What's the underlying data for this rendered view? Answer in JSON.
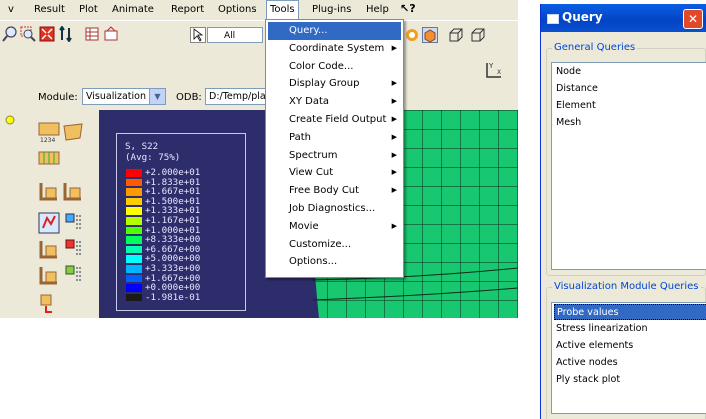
{
  "menubar": {
    "items": [
      "v",
      "Result",
      "Plot",
      "Animate",
      "Report",
      "Options",
      "Tools",
      "Plug-ins",
      "Help"
    ],
    "active": "Tools"
  },
  "toolbar": {
    "selection_combo": "All"
  },
  "context_bar": {
    "module_label": "Module:",
    "module_value": "Visualization",
    "odb_label": "ODB:",
    "odb_value": "D:/Temp/pla"
  },
  "legend": {
    "title": "S, S22",
    "subtitle": "(Avg: 75%)",
    "values": [
      "+2.000e+01",
      "+1.833e+01",
      "+1.667e+01",
      "+1.500e+01",
      "+1.333e+01",
      "+1.167e+01",
      "+1.000e+01",
      "+8.333e+00",
      "+6.667e+00",
      "+5.000e+00",
      "+3.333e+00",
      "+1.667e+00",
      "+0.000e+00",
      "-1.981e-01"
    ],
    "colors": [
      "#ff0000",
      "#ff5a00",
      "#ff9900",
      "#ffcc00",
      "#ffff00",
      "#b3ff00",
      "#4dff00",
      "#00ff5a",
      "#00ffb0",
      "#00ffff",
      "#00b4ff",
      "#0060ff",
      "#0000ff",
      "#1a1a1a"
    ]
  },
  "tools_menu": {
    "items": [
      {
        "label": "Query...",
        "submenu": false,
        "selected": true
      },
      {
        "label": "Coordinate System",
        "submenu": true
      },
      {
        "label": "Color Code...",
        "submenu": false
      },
      {
        "label": "Display Group",
        "submenu": true
      },
      {
        "label": "XY Data",
        "submenu": true
      },
      {
        "label": "Create Field Output",
        "submenu": true
      },
      {
        "label": "Path",
        "submenu": true
      },
      {
        "label": "Spectrum",
        "submenu": true
      },
      {
        "label": "View Cut",
        "submenu": true
      },
      {
        "label": "Free Body Cut",
        "submenu": true
      },
      {
        "label": "Job Diagnostics...",
        "submenu": false
      },
      {
        "label": "Movie",
        "submenu": true
      },
      {
        "label": "Customize...",
        "submenu": false
      },
      {
        "label": "Options...",
        "submenu": false
      }
    ]
  },
  "query_dialog": {
    "title": "Query",
    "general_title": "General Queries",
    "general_items": [
      "Node",
      "Distance",
      "Element",
      "Mesh"
    ],
    "viz_title": "Visualization Module Queries",
    "viz_items": [
      "Probe values",
      "Stress linearization",
      "Active elements",
      "Active nodes",
      "Ply stack plot"
    ],
    "viz_selected": "Probe values"
  }
}
